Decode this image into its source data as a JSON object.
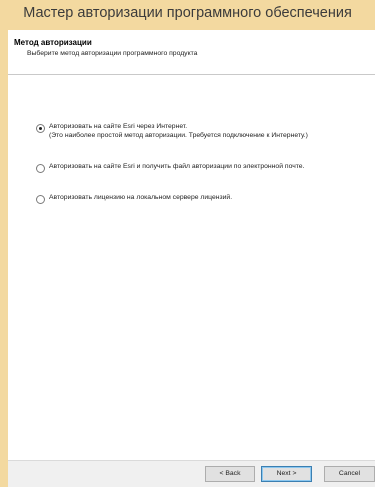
{
  "window": {
    "title": "Мастер авторизации программного обеспечения"
  },
  "header": {
    "title": "Метод авторизации",
    "subtitle": "Выберите метод авторизации программного продукта"
  },
  "options": [
    {
      "line1": "Авторизовать на сайте Esri через Интернет.",
      "line2": "(Это наиболее простой метод авторизации. Требуется подключение к Интернету.)",
      "selected": true
    },
    {
      "line1": "Авторизовать на сайте Esri и получить файл авторизации по электронной почте.",
      "line2": "",
      "selected": false
    },
    {
      "line1": "Авторизовать лицензию на локальном сервере лицензий.",
      "line2": "",
      "selected": false
    }
  ],
  "buttons": {
    "back": "< Back",
    "next": "Next >",
    "cancel": "Cancel"
  }
}
